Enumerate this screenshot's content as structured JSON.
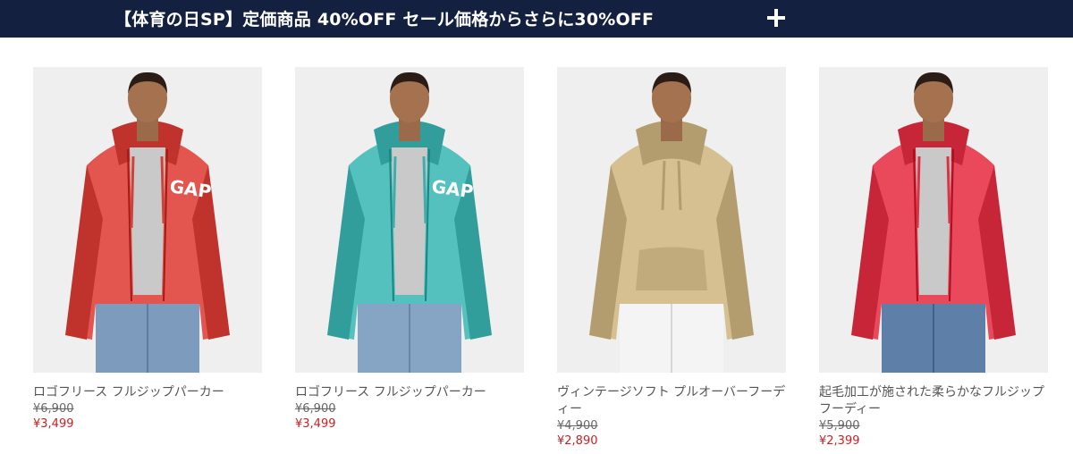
{
  "banner": {
    "text": "【体育の日SP】定価商品 40%OFF  セール価格からさらに30%OFF",
    "expand_icon": "plus-icon"
  },
  "products": [
    {
      "name": "ロゴフリース フルジップパーカー",
      "original_price": "¥6,900",
      "sale_price": "¥3,499",
      "hoodie_color": "#e2564f",
      "pants_color": "#7d9bbd",
      "style": "zip",
      "logo": "GAP"
    },
    {
      "name": "ロゴフリース フルジップパーカー",
      "original_price": "¥6,900",
      "sale_price": "¥3,499",
      "hoodie_color": "#55c1bf",
      "pants_color": "#86a4c4",
      "style": "zip",
      "logo": "GAP"
    },
    {
      "name": "ヴィンテージソフト プルオーバーフーディー",
      "original_price": "¥4,900",
      "sale_price": "¥2,890",
      "hoodie_color": "#d6c091",
      "pants_color": "#f4f4f4",
      "style": "pullover"
    },
    {
      "name": "起毛加工が施された柔らかなフルジップフーディー",
      "original_price": "¥5,900",
      "sale_price": "¥2,399",
      "hoodie_color": "#e9495a",
      "pants_color": "#5e7fa8",
      "style": "zip"
    }
  ],
  "colors": {
    "banner_bg": "#13203f",
    "sale_red": "#cc1f1f"
  }
}
